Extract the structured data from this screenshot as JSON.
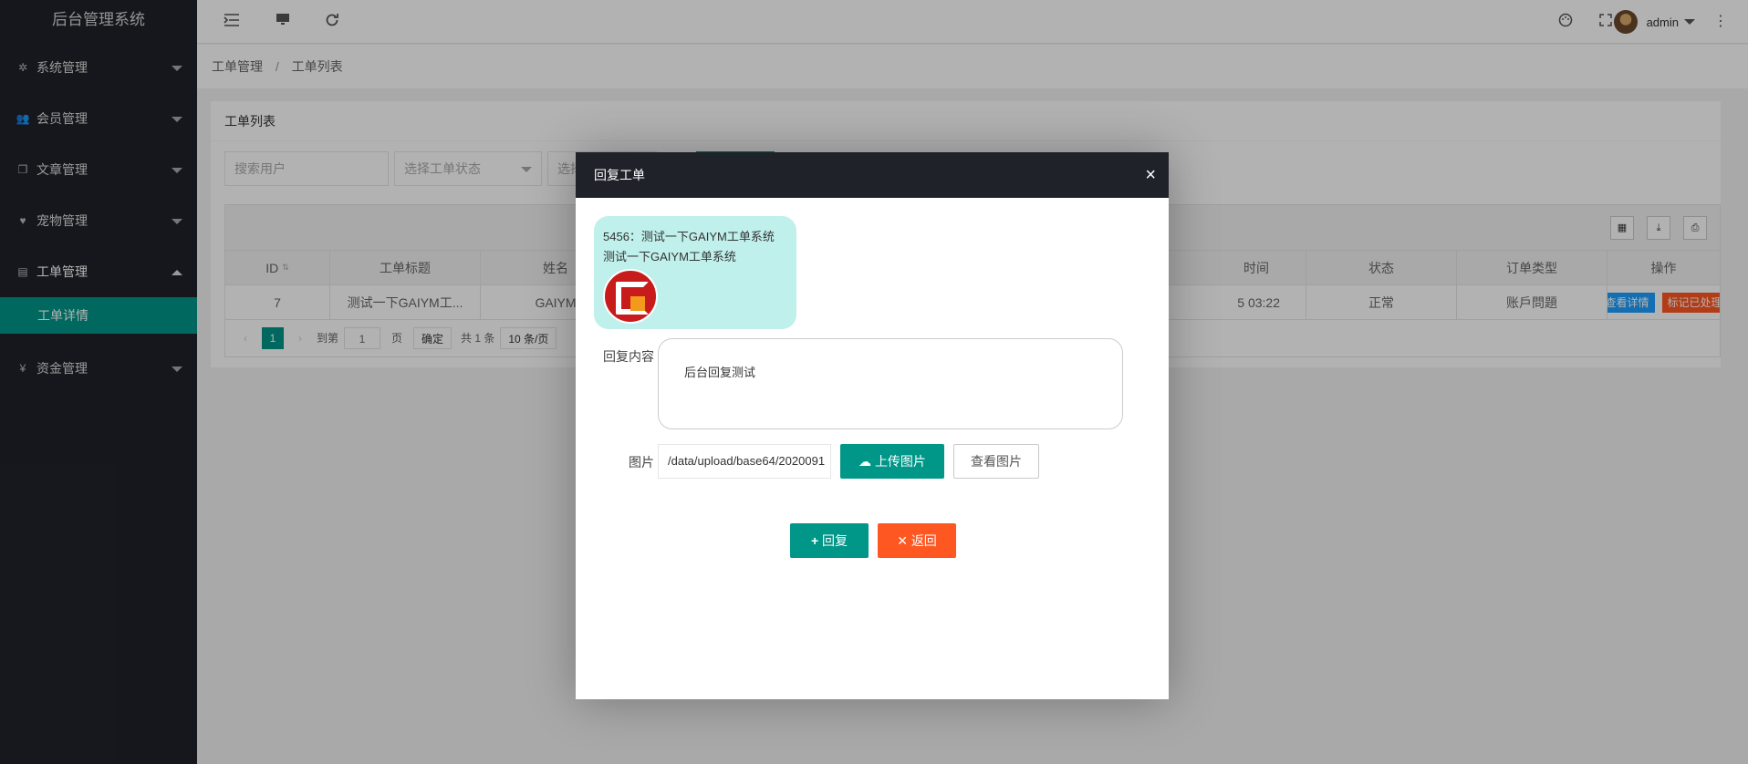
{
  "app": {
    "title": "后台管理系统"
  },
  "sidebar": {
    "items": [
      {
        "label": "系统管理",
        "icon": "gear-icon"
      },
      {
        "label": "会员管理",
        "icon": "users-icon"
      },
      {
        "label": "文章管理",
        "icon": "copy-icon"
      },
      {
        "label": "宠物管理",
        "icon": "heart-icon"
      },
      {
        "label": "工单管理",
        "icon": "file-icon",
        "expanded": true
      },
      {
        "label": "资金管理",
        "icon": "yen-icon"
      }
    ],
    "sub_item": "工单详情",
    "yen_glyph": "¥"
  },
  "header": {
    "username": "admin"
  },
  "breadcrumb": {
    "parent": "工单管理",
    "separator": "/",
    "current": "工单列表"
  },
  "card": {
    "title": "工单列表",
    "search_user_placeholder": "搜索用户",
    "status_select_placeholder": "选择工单状态",
    "third_select_partial": "选择"
  },
  "table": {
    "columns": [
      "ID",
      "工单标题",
      "姓名",
      "时间",
      "状态",
      "订单类型",
      "操作"
    ],
    "rows": [
      {
        "id": "7",
        "title": "测试一下GAIYM工...",
        "name": "GAIYM",
        "time": "5 03:22",
        "status": "正常",
        "type": "账戶問題",
        "actions": [
          "查看详情",
          "标记已处理"
        ]
      }
    ]
  },
  "pager": {
    "current": "1",
    "goto_label": "到第",
    "goto_value": "1",
    "page_unit": "页",
    "confirm": "确定",
    "total": "共 1 条",
    "per_page": "10 条/页"
  },
  "modal": {
    "title": "回复工单",
    "close_glyph": "×",
    "message_line1": "5456：测试一下GAIYM工单系统",
    "message_line2": "测试一下GAIYM工单系统",
    "reply_label": "回复内容",
    "reply_value": "后台回复测试",
    "image_label": "图片",
    "image_path": "/data/upload/base64/2020091",
    "upload_button": "上传图片",
    "view_button": "查看图片",
    "reply_button": "回复",
    "back_button": "返回"
  },
  "colors": {
    "primary": "#009688",
    "danger": "#ff5722",
    "info": "#1e9fff",
    "sidebar": "#20222a",
    "bubble": "#c0f0ec"
  }
}
